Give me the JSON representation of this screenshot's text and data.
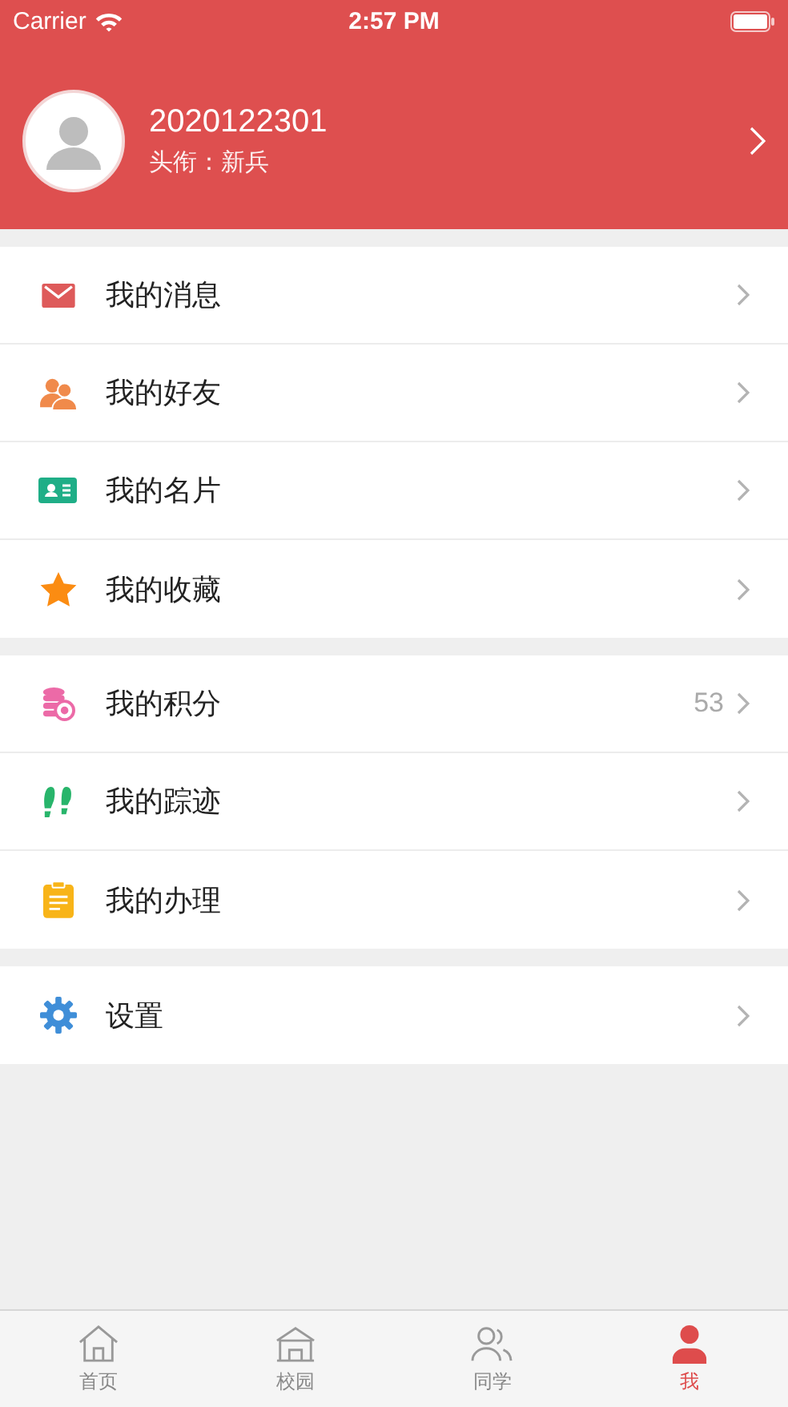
{
  "status_bar": {
    "carrier": "Carrier",
    "time": "2:57 PM"
  },
  "profile": {
    "name": "2020122301",
    "title": "头衔：新兵"
  },
  "groups": [
    {
      "items": [
        {
          "kind": "mail",
          "label": "我的消息"
        },
        {
          "kind": "friends",
          "label": "我的好友"
        },
        {
          "kind": "card",
          "label": "我的名片"
        },
        {
          "kind": "star",
          "label": "我的收藏"
        }
      ]
    },
    {
      "items": [
        {
          "kind": "points",
          "label": "我的积分",
          "value": "53"
        },
        {
          "kind": "footprints",
          "label": "我的踪迹"
        },
        {
          "kind": "clipboard",
          "label": "我的办理"
        }
      ]
    },
    {
      "items": [
        {
          "kind": "gear",
          "label": "设置"
        }
      ]
    }
  ],
  "tabs": [
    {
      "kind": "home",
      "label": "首页",
      "selected": false
    },
    {
      "kind": "campus",
      "label": "校园",
      "selected": false
    },
    {
      "kind": "classmates",
      "label": "同学",
      "selected": false
    },
    {
      "kind": "me",
      "label": "我",
      "selected": true
    }
  ]
}
